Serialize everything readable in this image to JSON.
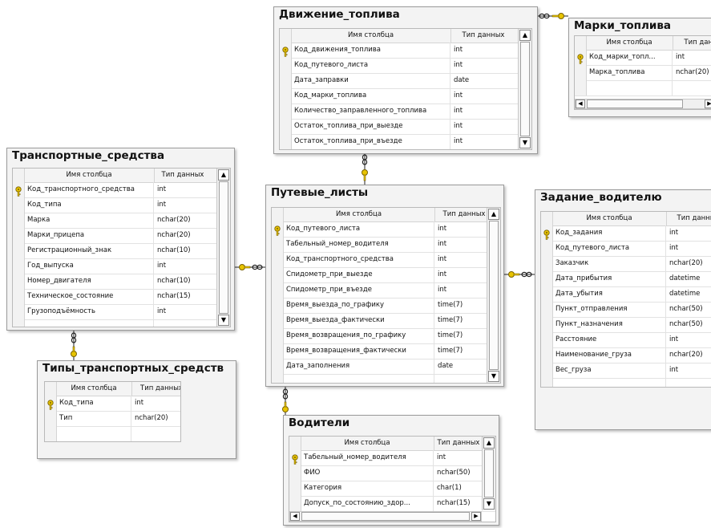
{
  "header": {
    "name": "Имя столбца",
    "type": "Тип данных"
  },
  "icons": {
    "primary_key": "key-icon",
    "relation_many": "infinity-icon",
    "relation_one": "key-icon"
  },
  "tables": {
    "dvizhenie": {
      "title": "Движение_топлива",
      "rows": [
        {
          "name": "Код_движения_топлива",
          "type": "int",
          "pk": true
        },
        {
          "name": "Код_путевого_листа",
          "type": "int"
        },
        {
          "name": "Дата_заправки",
          "type": "date"
        },
        {
          "name": "Код_марки_топлива",
          "type": "int"
        },
        {
          "name": "Количество_заправленного_топлива",
          "type": "int"
        },
        {
          "name": "Остаток_топлива_при_выезде",
          "type": "int"
        },
        {
          "name": "Остаток_топлива_при_въезде",
          "type": "int"
        }
      ]
    },
    "marki": {
      "title": "Марки_топлива",
      "header_type": "Тип данн",
      "rows": [
        {
          "name": "Код_марки_топл...",
          "type": "int",
          "pk": true
        },
        {
          "name": "Марка_топлива",
          "type": "nchar(20)"
        }
      ]
    },
    "transport": {
      "title": "Транспортные_средства",
      "rows": [
        {
          "name": "Код_транспортного_средства",
          "type": "int",
          "pk": true
        },
        {
          "name": "Код_типа",
          "type": "int"
        },
        {
          "name": "Марка",
          "type": "nchar(20)"
        },
        {
          "name": "Марки_прицепа",
          "type": "nchar(20)"
        },
        {
          "name": "Регистрационный_знак",
          "type": "nchar(10)"
        },
        {
          "name": "Год_выпуска",
          "type": "int"
        },
        {
          "name": "Номер_двигателя",
          "type": "nchar(10)"
        },
        {
          "name": "Техническое_состояние",
          "type": "nchar(15)"
        },
        {
          "name": "Грузоподъёмность",
          "type": "int"
        }
      ]
    },
    "putevye": {
      "title": "Путевые_листы",
      "rows": [
        {
          "name": "Код_путевого_листа",
          "type": "int",
          "pk": true
        },
        {
          "name": "Табельный_номер_водителя",
          "type": "int"
        },
        {
          "name": "Код_транспортного_средства",
          "type": "int"
        },
        {
          "name": "Спидометр_при_выезде",
          "type": "int"
        },
        {
          "name": "Спидометр_при_въезде",
          "type": "int"
        },
        {
          "name": "Время_выезда_по_графику",
          "type": "time(7)"
        },
        {
          "name": "Время_выезда_фактически",
          "type": "time(7)"
        },
        {
          "name": "Время_возвращения_по_графику",
          "type": "time(7)"
        },
        {
          "name": "Время_возвращения_фактически",
          "type": "time(7)"
        },
        {
          "name": "Дата_заполнения",
          "type": "date"
        }
      ]
    },
    "zadanie": {
      "title": "Задание_водителю",
      "rows": [
        {
          "name": "Код_задания",
          "type": "int",
          "pk": true
        },
        {
          "name": "Код_путевого_листа",
          "type": "int"
        },
        {
          "name": "Заказчик",
          "type": "nchar(20)"
        },
        {
          "name": "Дата_прибытия",
          "type": "datetime"
        },
        {
          "name": "Дата_убытия",
          "type": "datetime"
        },
        {
          "name": "Пункт_отправления",
          "type": "nchar(50)"
        },
        {
          "name": "Пункт_назначения",
          "type": "nchar(50)"
        },
        {
          "name": "Расстояние",
          "type": "int"
        },
        {
          "name": "Наименование_груза",
          "type": "nchar(20)"
        },
        {
          "name": "Вес_груза",
          "type": "int"
        }
      ]
    },
    "tipy": {
      "title": "Типы_транспортных_средств",
      "rows": [
        {
          "name": "Код_типа",
          "type": "int",
          "pk": true
        },
        {
          "name": "Тип",
          "type": "nchar(20)"
        }
      ]
    },
    "voditeli": {
      "title": "Водители",
      "rows": [
        {
          "name": "Табельный_номер_водителя",
          "type": "int",
          "pk": true
        },
        {
          "name": "ФИО",
          "type": "nchar(50)"
        },
        {
          "name": "Категория",
          "type": "char(1)"
        },
        {
          "name": "Допуск_по_состоянию_здор...",
          "type": "nchar(15)"
        }
      ]
    }
  },
  "colors": {
    "key_yellow": "#e8c400",
    "key_outline": "#7a6200",
    "connector": "#222222",
    "table_shadow": "#bbbbbb"
  }
}
